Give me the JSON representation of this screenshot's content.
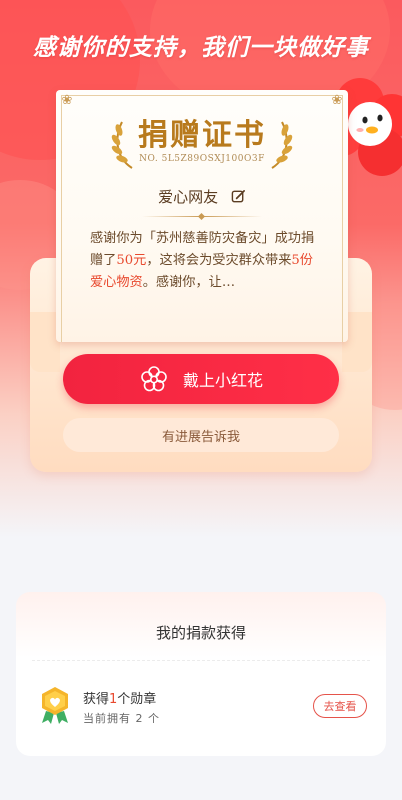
{
  "header": {
    "headline": "感谢你的支持，我们一块做好事"
  },
  "certificate": {
    "title": "捐赠证书",
    "number": "NO. 5L5Z89OSXJ100O3F",
    "donor_name": "爱心网友",
    "text_part1": "感谢你为「苏州慈善防灾备灾」成功捐赠了",
    "amount": "50元",
    "text_part2": "，这将会为受灾群众带来",
    "goods": "5份爱心物资",
    "text_part3": "。感谢你，让…"
  },
  "actions": {
    "primary_label": "戴上小红花",
    "secondary_label": "有进展告诉我"
  },
  "rewards": {
    "title": "我的捐款获得",
    "badge_prefix": "获得",
    "badge_count": "1",
    "badge_suffix": "个勋章",
    "owned_text": "当前拥有 2 个",
    "view_label": "去查看"
  },
  "colors": {
    "accent": "#f2233f",
    "brand_gold": "#b87a1d",
    "hero_red": "#fb5a5e"
  }
}
